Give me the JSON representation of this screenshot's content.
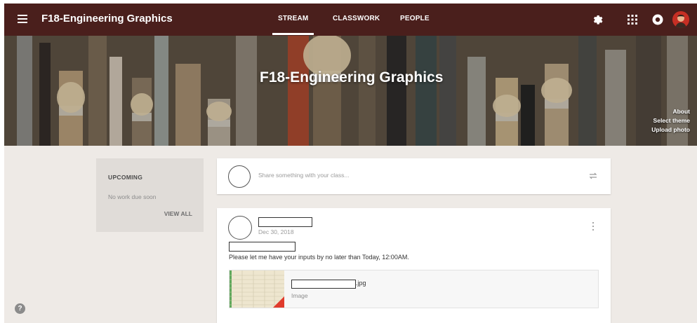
{
  "header": {
    "course_title": "F18-Engineering Graphics",
    "tabs": [
      {
        "label": "STREAM",
        "active": true
      },
      {
        "label": "CLASSWORK",
        "active": false
      },
      {
        "label": "PEOPLE",
        "active": false
      }
    ],
    "icons": [
      "menu-icon",
      "gear-icon",
      "apps-icon",
      "account-icon",
      "avatar"
    ]
  },
  "banner": {
    "title": "F18-Engineering Graphics",
    "links": [
      "About",
      "Select theme",
      "Upload photo"
    ]
  },
  "upcoming": {
    "title": "UPCOMING",
    "subtitle": "No work due soon",
    "view_all": "VIEW ALL"
  },
  "share": {
    "placeholder": "Share something with your class..."
  },
  "post": {
    "date": "Dec 30, 2018",
    "text": "Please let me have your inputs by no later than Today, 12:00AM.",
    "attachment": {
      "extension": ".jpg",
      "type": "Image"
    }
  },
  "colors": {
    "topbar": "#4a1f1c",
    "page_background": "#eeeae6",
    "card": "#ffffff"
  }
}
